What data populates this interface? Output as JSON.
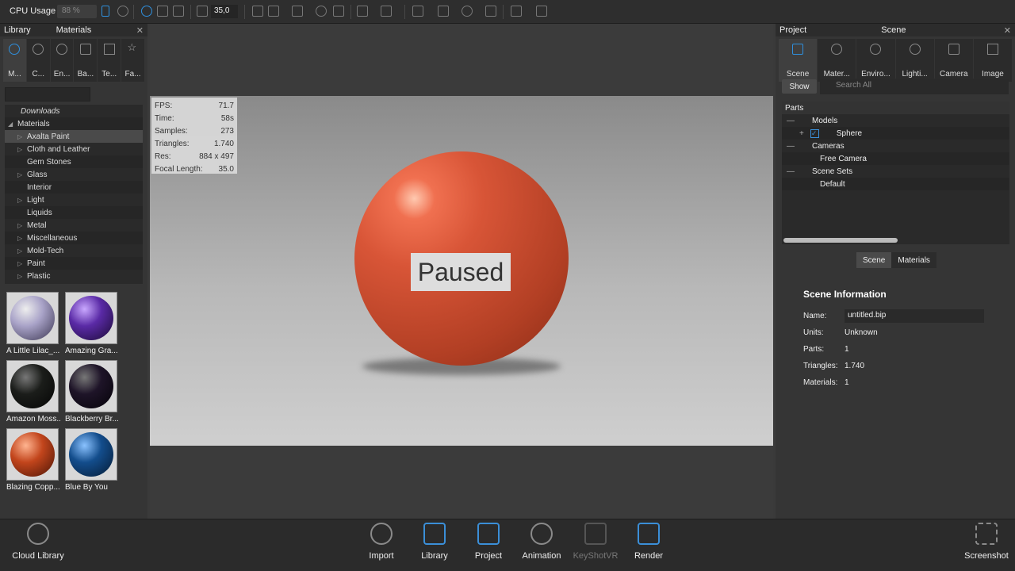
{
  "toolbar": {
    "cpu_label": "CPU Usage",
    "cpu_value": "88 %",
    "zoom_value": "35,0"
  },
  "library": {
    "panel_title": "Library",
    "panel_subtitle": "Materials",
    "tabs": [
      {
        "label": "M..."
      },
      {
        "label": "C..."
      },
      {
        "label": "En..."
      },
      {
        "label": "Ba..."
      },
      {
        "label": "Te..."
      },
      {
        "label": "Fa..."
      }
    ],
    "tree": [
      "Downloads",
      "Materials",
      "Axalta Paint",
      "Cloth and Leather",
      "Gem Stones",
      "Glass",
      "Interior",
      "Light",
      "Liquids",
      "Metal",
      "Miscellaneous",
      "Mold-Tech",
      "Paint",
      "Plastic"
    ],
    "thumbs": [
      {
        "label": "A Little Lilac_...",
        "color": "#a9a3c8"
      },
      {
        "label": "Amazing Gra...",
        "color": "#5a2aa6"
      },
      {
        "label": "Amazon Moss...",
        "color": "#1b1d1a"
      },
      {
        "label": "Blackberry Br...",
        "color": "#1e1428"
      },
      {
        "label": "Blazing Copp...",
        "color": "#c2451c"
      },
      {
        "label": "Blue By You",
        "color": "#134d8c"
      }
    ]
  },
  "viewport": {
    "stats": [
      {
        "k": "FPS:",
        "v": "71.7"
      },
      {
        "k": "Time:",
        "v": "58s"
      },
      {
        "k": "Samples:",
        "v": "273"
      },
      {
        "k": "Triangles:",
        "v": "1.740"
      },
      {
        "k": "Res:",
        "v": "884 x 497"
      },
      {
        "k": "Focal Length:",
        "v": "35.0"
      }
    ],
    "paused": "Paused"
  },
  "project": {
    "panel_title": "Project",
    "panel_subtitle": "Scene",
    "tabs": [
      {
        "label": "Scene"
      },
      {
        "label": "Mater..."
      },
      {
        "label": "Enviro..."
      },
      {
        "label": "Lighti..."
      },
      {
        "label": "Camera"
      },
      {
        "label": "Image"
      }
    ],
    "show_button": "Show",
    "search_placeholder": "Search All",
    "parts_header": "Parts",
    "parts": [
      {
        "label": "Models"
      },
      {
        "label": "Sphere"
      },
      {
        "label": "Cameras"
      },
      {
        "label": "Free Camera"
      },
      {
        "label": "Scene Sets"
      },
      {
        "label": "Default"
      }
    ],
    "subtabs": [
      "Scene",
      "Materials"
    ],
    "info_title": "Scene Information",
    "fields": [
      {
        "k": "Name:",
        "v": "untitled.bip"
      },
      {
        "k": "Units:",
        "v": "Unknown"
      },
      {
        "k": "Parts:",
        "v": "1"
      },
      {
        "k": "Triangles:",
        "v": "1.740"
      },
      {
        "k": "Materials:",
        "v": "1"
      }
    ]
  },
  "bottom": {
    "cloud": "Cloud Library",
    "items": [
      "Import",
      "Library",
      "Project",
      "Animation",
      "KeyShotVR",
      "Render"
    ],
    "screenshot": "Screenshot"
  }
}
